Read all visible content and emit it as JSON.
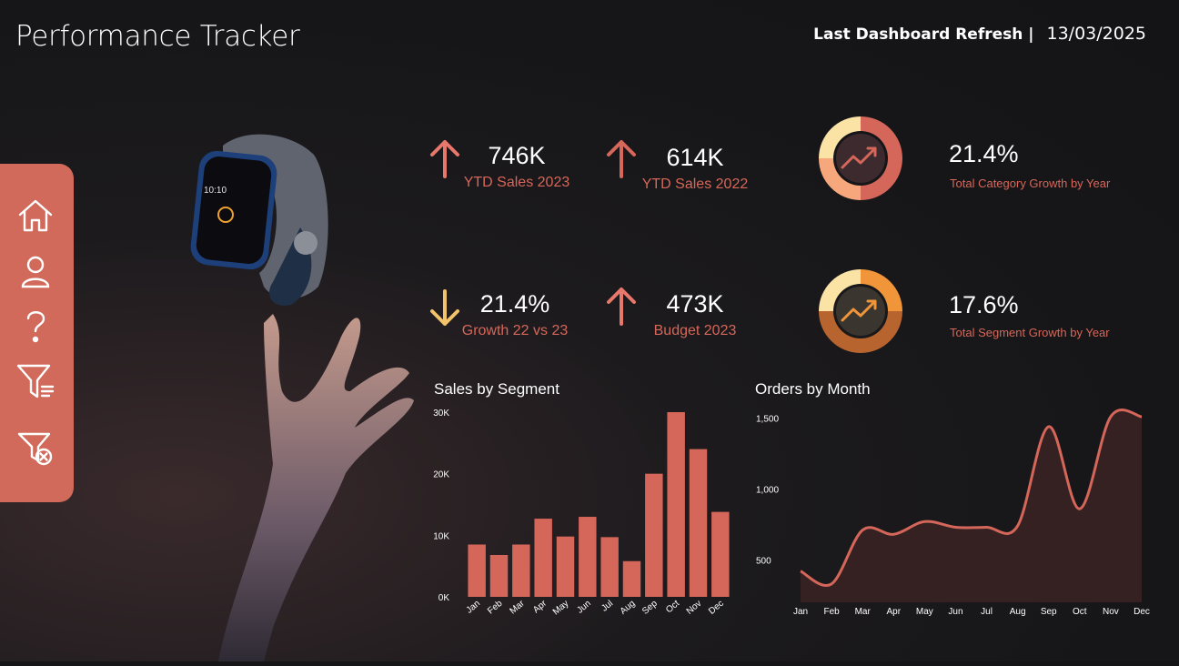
{
  "header": {
    "title": "Performance Tracker",
    "refresh_label": "Last Dashboard Refresh |",
    "refresh_date": "13/03/2025"
  },
  "sidebar": {
    "items": [
      {
        "icon": "home-icon"
      },
      {
        "icon": "user-icon"
      },
      {
        "icon": "help-icon"
      },
      {
        "icon": "filter-icon"
      },
      {
        "icon": "clear-filter-icon"
      }
    ]
  },
  "kpis": [
    {
      "value": "746K",
      "label": "YTD Sales 2023",
      "trend": "up",
      "color": "#e8776c"
    },
    {
      "value": "614K",
      "label": "YTD Sales 2022",
      "trend": "up",
      "color": "#d6675a"
    },
    {
      "value": "21.4%",
      "label": "Growth 22 vs 23",
      "trend": "down",
      "color": "#f2c36b"
    },
    {
      "value": "473K",
      "label": "Budget 2023",
      "trend": "up",
      "color": "#e8776c"
    }
  ],
  "rings": [
    {
      "value": "21.4%",
      "label": "Total Category Growth by Year"
    },
    {
      "value": "17.6%",
      "label": "Total Segment Growth by Year"
    }
  ],
  "colors": {
    "accent": "#d16a5a",
    "label": "#d6675a",
    "bar": "#d4665a",
    "line": "#d4665a",
    "orange": "#f0953a",
    "cream": "#fbe3a6"
  },
  "chart_data": [
    {
      "type": "bar",
      "title": "Sales by Segment",
      "categories": [
        "Jan",
        "Feb",
        "Mar",
        "Apr",
        "May",
        "Jun",
        "Jul",
        "Aug",
        "Sep",
        "Oct",
        "Nov",
        "Dec"
      ],
      "values": [
        8500,
        6800,
        8500,
        12700,
        9800,
        13000,
        9700,
        5800,
        20000,
        30000,
        24000,
        13800
      ],
      "ylim": [
        0,
        30000
      ],
      "yticks": [
        "0K",
        "10K",
        "20K",
        "30K"
      ],
      "ytick_values": [
        0,
        10000,
        20000,
        30000
      ],
      "grid": false
    },
    {
      "type": "area",
      "title": "Orders by Month",
      "categories": [
        "Jan",
        "Feb",
        "Mar",
        "Apr",
        "May",
        "Jun",
        "Jul",
        "Aug",
        "Sep",
        "Oct",
        "Nov",
        "Dec"
      ],
      "values": [
        420,
        330,
        710,
        680,
        770,
        730,
        730,
        740,
        1440,
        860,
        1510,
        1510
      ],
      "ylim": [
        200,
        1600
      ],
      "yticks": [
        "500",
        "1,000",
        "1,500"
      ],
      "ytick_values": [
        500,
        1000,
        1500
      ],
      "grid": false
    }
  ]
}
